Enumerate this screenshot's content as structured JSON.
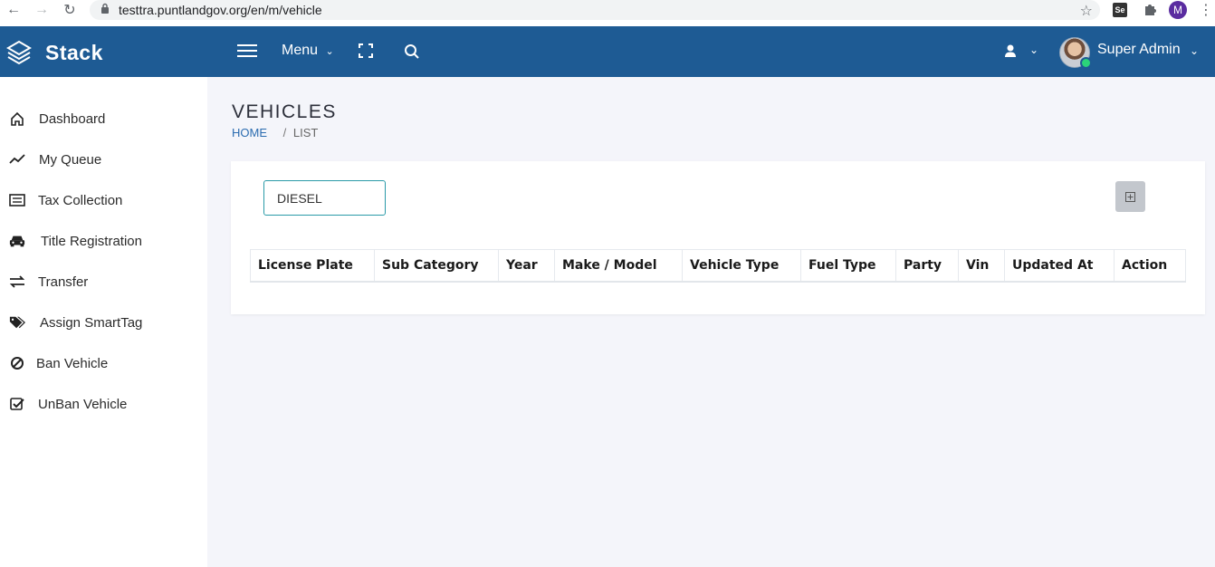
{
  "browser": {
    "url": "testtra.puntlandgov.org/en/m/vehicle",
    "profile_initial": "M",
    "se_label": "Se"
  },
  "header": {
    "brand": "Stack",
    "menu_label": "Menu",
    "user_name": "Super Admin"
  },
  "sidebar": {
    "items": [
      {
        "label": "Dashboard",
        "icon": "home-icon"
      },
      {
        "label": "My Queue",
        "icon": "trend-line-icon"
      },
      {
        "label": "Tax Collection",
        "icon": "list-icon"
      },
      {
        "label": "Title Registration",
        "icon": "car-icon"
      },
      {
        "label": "Transfer",
        "icon": "exchange-icon"
      },
      {
        "label": "Assign SmartTag",
        "icon": "tags-icon"
      },
      {
        "label": "Ban Vehicle",
        "icon": "ban-icon"
      },
      {
        "label": "UnBan Vehicle",
        "icon": "check-square-icon"
      }
    ]
  },
  "page": {
    "title": "VEHICLES",
    "breadcrumb_home": "HOME",
    "breadcrumb_sep": "/",
    "breadcrumb_current": "LIST"
  },
  "filter": {
    "value": "DIESEL"
  },
  "table": {
    "columns": [
      "License Plate",
      "Sub Category",
      "Year",
      "Make / Model",
      "Vehicle Type",
      "Fuel Type",
      "Party",
      "Vin",
      "Updated At",
      "Action"
    ]
  },
  "colors": {
    "header_bg": "#1e5b94",
    "input_border": "#2a9aa8",
    "link": "#2b6cb0"
  }
}
